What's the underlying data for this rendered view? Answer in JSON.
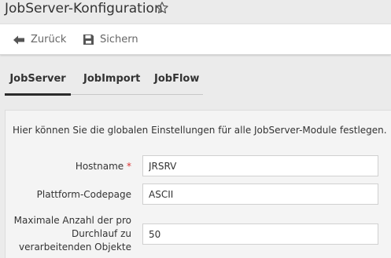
{
  "header": {
    "title": "JobServer-Konfiguration",
    "favorite_icon": "star-outline-icon"
  },
  "toolbar": {
    "back_label": "Zurück",
    "back_icon": "arrow-left-icon",
    "save_label": "Sichern",
    "save_icon": "floppy-disk-icon"
  },
  "tabs": [
    {
      "label": "JobServer",
      "active": true
    },
    {
      "label": "JobImport",
      "active": false
    },
    {
      "label": "JobFlow",
      "active": false
    }
  ],
  "panel": {
    "description": "Hier können Sie die globalen Einstellungen für alle JobServer-Module festlegen.",
    "fields": [
      {
        "label": "Hostname",
        "required_mark": "*",
        "value": "JRSRV"
      },
      {
        "label": "Plattform-Codepage",
        "value": "ASCII"
      },
      {
        "label": "Maximale Anzahl der pro Durchlauf zu verarbeitenden Objekte",
        "value": "50"
      }
    ]
  },
  "colors": {
    "background": "#ebebeb",
    "toolbar": "#ffffff",
    "panel": "#f4f4f4",
    "required": "#dd3333",
    "active_tab_underline": "#2b2b2b"
  }
}
